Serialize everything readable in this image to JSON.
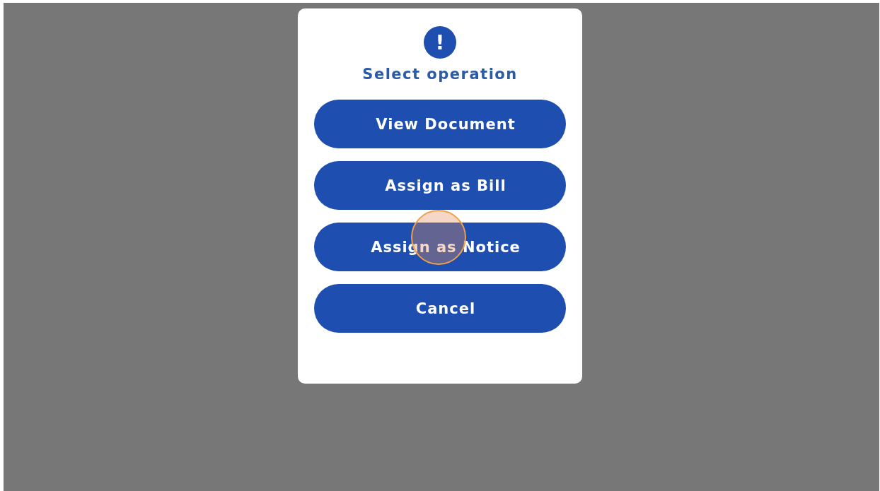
{
  "dialog": {
    "icon": "!",
    "title": "Select operation"
  },
  "buttons": [
    {
      "label": "View Document",
      "clicked": false
    },
    {
      "label": "Assign as Bill",
      "clicked": false
    },
    {
      "label": "Assign as Notice",
      "clicked": true
    },
    {
      "label": "Cancel",
      "clicked": false
    }
  ]
}
